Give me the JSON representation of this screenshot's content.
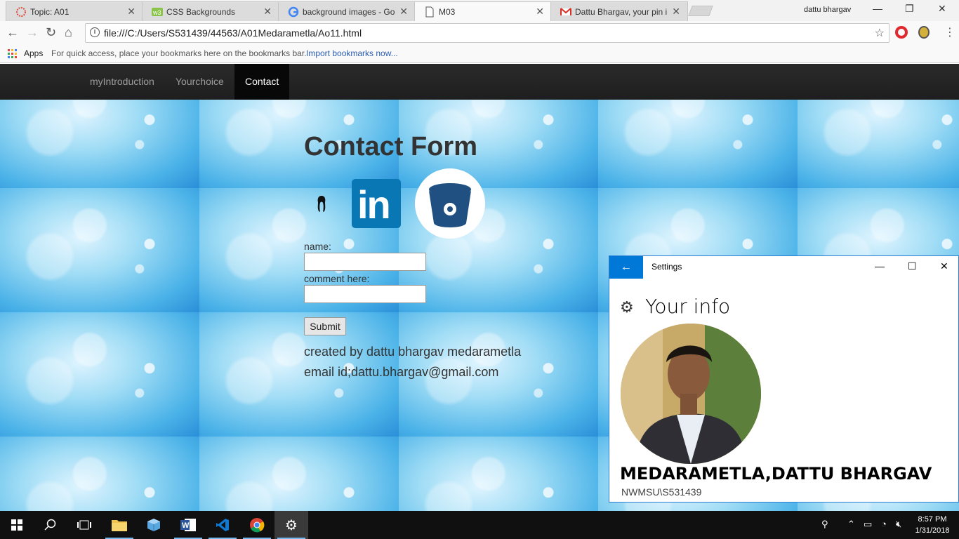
{
  "browser": {
    "tabs": [
      {
        "label": "Topic: A01",
        "icon": "lotus-icon"
      },
      {
        "label": "CSS Backgrounds",
        "icon": "w3schools-icon"
      },
      {
        "label": "background images - Go",
        "icon": "google-icon"
      },
      {
        "label": "M03",
        "icon": "document-icon"
      },
      {
        "label": "Dattu Bhargav, your pin i",
        "icon": "gmail-icon"
      }
    ],
    "profile_name": "dattu bhargav",
    "url": "file:///C:/Users/S531439/44563/A01Medarametla/Ao11.html",
    "bookmarks": {
      "apps_label": "Apps",
      "hint": "For quick access, place your bookmarks here on the bookmarks bar.",
      "import_link": "Import bookmarks now..."
    }
  },
  "site": {
    "nav": [
      "myIntroduction",
      "Yourchoice",
      "Contact"
    ],
    "active_nav": "Contact",
    "form_title": "Contact Form",
    "social_icons": [
      "github-icon",
      "linkedin-icon",
      "bitbucket-icon"
    ],
    "linkedin_text": "in",
    "name_label": "name:",
    "name_value": "",
    "comment_label": "comment here:",
    "comment_value": "",
    "submit_label": "Submit",
    "created_by": "created by dattu bhargav medarametla",
    "email": "email id;dattu.bhargav@gmail.com"
  },
  "settings": {
    "window_title": "Settings",
    "heading": "Your info",
    "user_name": "MEDARAMETLA,DATTU BHARGAV",
    "user_id": "NWMSU\\S531439"
  },
  "taskbar": {
    "time": "8:57 PM",
    "date": "1/31/2018"
  },
  "colors": {
    "nav_bg": "#222222",
    "accent_blue": "#0078d7",
    "linkedin_blue": "#0a77b5",
    "bitbucket_blue": "#205081"
  }
}
